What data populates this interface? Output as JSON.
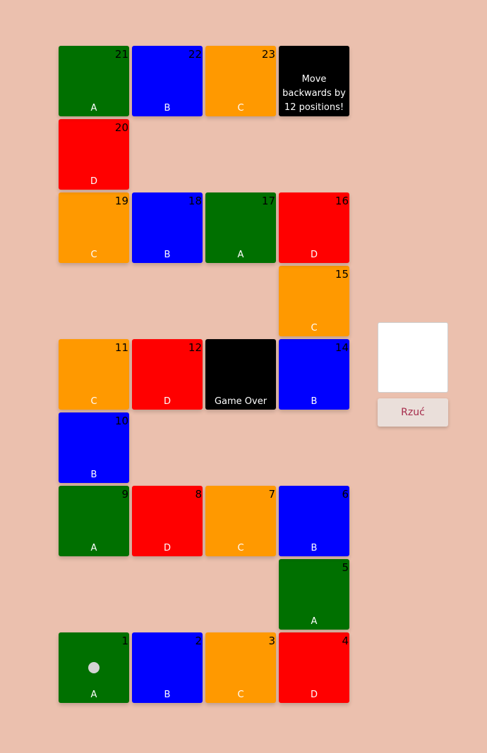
{
  "colors": {
    "green": "#007000",
    "blue": "#0000ff",
    "orange": "#ff9900",
    "red": "#ff0000",
    "black": "#000000",
    "background": "#ebc0ae"
  },
  "tiles": [
    {
      "num": "1",
      "label": "A",
      "color": "green",
      "pawn": true
    },
    {
      "num": "2",
      "label": "B",
      "color": "blue"
    },
    {
      "num": "3",
      "label": "C",
      "color": "orange"
    },
    {
      "num": "4",
      "label": "D",
      "color": "red"
    },
    {
      "num": "5",
      "label": "A",
      "color": "green"
    },
    {
      "num": "6",
      "label": "B",
      "color": "blue"
    },
    {
      "num": "7",
      "label": "C",
      "color": "orange"
    },
    {
      "num": "8",
      "label": "D",
      "color": "red"
    },
    {
      "num": "9",
      "label": "A",
      "color": "green"
    },
    {
      "num": "10",
      "label": "B",
      "color": "blue"
    },
    {
      "num": "11",
      "label": "C",
      "color": "orange"
    },
    {
      "num": "12",
      "label": "D",
      "color": "red"
    },
    {
      "num": "",
      "label": "Game Over",
      "color": "black"
    },
    {
      "num": "14",
      "label": "B",
      "color": "blue"
    },
    {
      "num": "15",
      "label": "C",
      "color": "orange"
    },
    {
      "num": "16",
      "label": "D",
      "color": "red"
    },
    {
      "num": "17",
      "label": "A",
      "color": "green"
    },
    {
      "num": "18",
      "label": "B",
      "color": "blue"
    },
    {
      "num": "19",
      "label": "C",
      "color": "orange"
    },
    {
      "num": "20",
      "label": "D",
      "color": "red"
    },
    {
      "num": "21",
      "label": "A",
      "color": "green"
    },
    {
      "num": "22",
      "label": "B",
      "color": "blue"
    },
    {
      "num": "23",
      "label": "C",
      "color": "orange"
    },
    {
      "num": "",
      "label": "Move backwards by 12 positions!",
      "color": "black"
    }
  ],
  "controls": {
    "roll_label": "Rzuć",
    "dice_value": ""
  }
}
